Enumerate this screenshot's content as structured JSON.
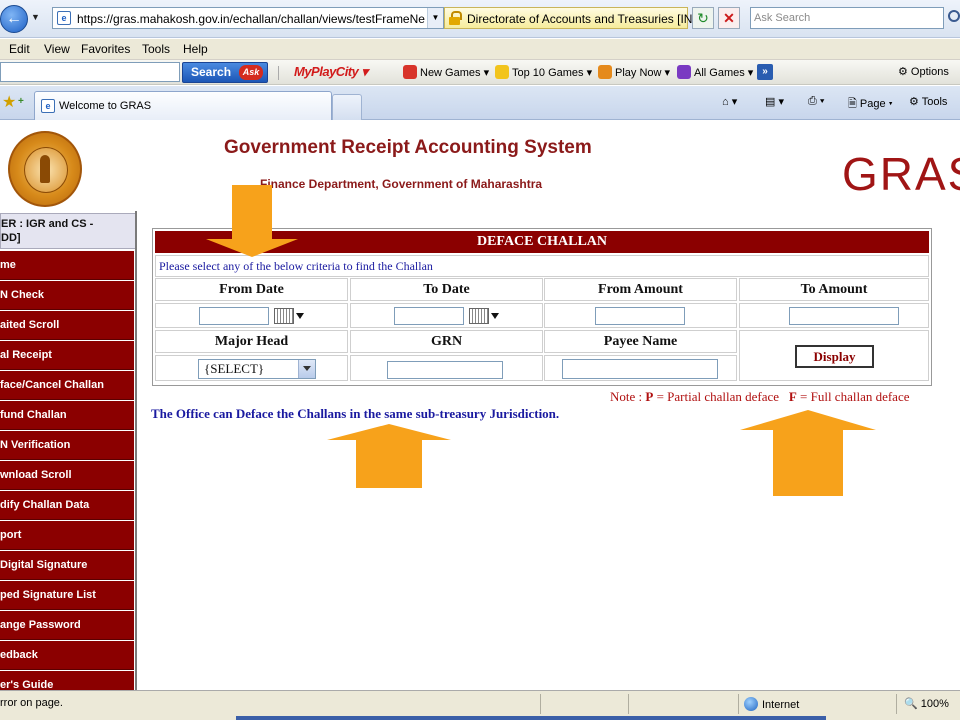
{
  "browser": {
    "url": "https://gras.mahakosh.gov.in/echallan/challan/views/testFrameNew.php",
    "site_identity": "Directorate of Accounts and Treasuries [IN]",
    "search_placeholder": "Ask Search",
    "menu": [
      "Edit",
      "View",
      "Favorites",
      "Tools",
      "Help"
    ],
    "ask_toolbar": {
      "search_label": "Search",
      "ask_logo": "Ask",
      "brand": "MyPlayCity",
      "links": [
        "New Games",
        "Top 10 Games",
        "Play Now",
        "All Games"
      ],
      "options_label": "Options"
    },
    "tab_title": "Welcome to GRAS",
    "commands": {
      "page": "Page",
      "tools": "Tools"
    },
    "status_message": "rror on page.",
    "zone": "Internet",
    "zoom": "100%"
  },
  "header": {
    "title": "Government Receipt Accounting System",
    "subtitle": "Finance Department, Government of Maharashtra",
    "logo_text": "GRAS"
  },
  "sidebar": {
    "user_line1": "ER : IGR and CS -",
    "user_line2": "DD]",
    "items": [
      "me",
      "N Check",
      "aited Scroll",
      "al Receipt",
      "face/Cancel Challan",
      "fund Challan",
      "N Verification",
      "wnload Scroll",
      "dify Challan Data",
      "port",
      "Digital Signature",
      "ped Signature List",
      "ange Password",
      "edback",
      "er's Guide"
    ]
  },
  "form": {
    "title": "DEFACE CHALLAN",
    "hint": "Please select any of the below criteria to find the Challan",
    "labels": {
      "from_date": "From Date",
      "to_date": "To Date",
      "from_amount": "From Amount",
      "to_amount": "To Amount",
      "major_head": "Major Head",
      "grn": "GRN",
      "payee_name": "Payee Name"
    },
    "major_head_selected": "{SELECT}",
    "display_button": "Display"
  },
  "note": {
    "prefix": "Note : ",
    "p_key": "P",
    "p_text": " = Partial challan deface",
    "f_key": "F",
    "f_text": " = Full challan deface"
  },
  "office_message": "The Office can Deface the Challans in the same sub-treasury Jurisdiction.",
  "colors": {
    "primary_maroon": "#8b0000",
    "hint_blue": "#1a1aa0",
    "note_red": "#b01010",
    "arrow_orange": "#f7a21b"
  }
}
